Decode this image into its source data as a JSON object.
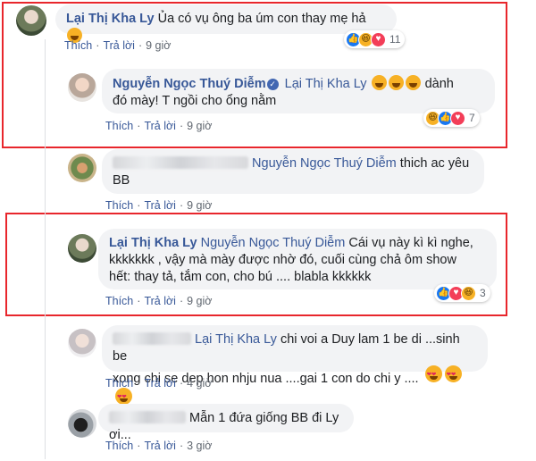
{
  "comments": [
    {
      "author": "Lại Thị Kha Ly",
      "text": "Ủa có vụ ông ba úm con thay mẹ hả",
      "actions": {
        "like": "Thích",
        "reply": "Trả lời",
        "time": "9 giờ"
      },
      "reactions": {
        "icons": [
          "like",
          "haha",
          "love"
        ],
        "count": "11"
      }
    },
    {
      "author": "Nguyễn Ngọc Thuý Diễm",
      "verified": true,
      "mention": "Lại Thị Kha Ly",
      "text_line1": "dành",
      "text_line2": "đó mày! T ngồi cho ổng nằm",
      "actions": {
        "like": "Thích",
        "reply": "Trả lời",
        "time": "9 giờ"
      },
      "reactions": {
        "icons": [
          "haha",
          "like",
          "love"
        ],
        "count": "7"
      }
    },
    {
      "mention": "Nguyễn Ngọc Thuý Diễm",
      "text_line1": "thich ac yêu",
      "text_line2": "BB",
      "actions": {
        "like": "Thích",
        "reply": "Trả lời",
        "time": "9 giờ"
      }
    },
    {
      "author": "Lại Thị Kha Ly",
      "mention": "Nguyễn Ngọc Thuý Diễm",
      "text_line1": "Cái vụ này kì kì nghe,",
      "text_line2": "kkkkkkk , vậy mà mày được nhờ đó, cuối cùng chả ôm show",
      "text_line3": "hết: thay tả, tắm con, cho bú .... blabla kkkkkk",
      "actions": {
        "like": "Thích",
        "reply": "Trả lời",
        "time": "9 giờ"
      },
      "reactions": {
        "icons": [
          "like",
          "love",
          "haha"
        ],
        "count": "3"
      }
    },
    {
      "mention": "Lại Thị Kha Ly",
      "text_line1": "chi voi a Duy lam 1 be di ...sinh be",
      "text_line2": "xong chi se dep hon nhju nua ....gai 1 con do chi y ....",
      "actions": {
        "like": "Thích",
        "reply": "Trả lời",
        "time": "4 giờ"
      }
    },
    {
      "text_line1": "Mẫn 1 đứa giống BB đi Ly ơi...",
      "actions": {
        "like": "Thích",
        "reply": "Trả lời",
        "time": "3 giờ"
      }
    }
  ],
  "colors": {
    "highlight_border": "#e8262c",
    "name_link": "#385898",
    "bubble_bg": "#f2f3f5"
  }
}
